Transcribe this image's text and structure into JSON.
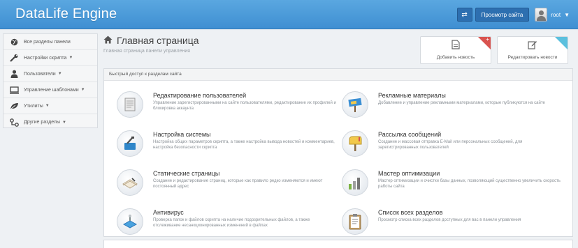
{
  "header": {
    "logo": "DataLife Engine",
    "swap_icon": "swap-icon",
    "view_site_label": "Просмотр сайта",
    "username": "root",
    "user_caret": "▼"
  },
  "sidebar": {
    "items": [
      {
        "label": "Все разделы панели",
        "icon": "globe-icon",
        "caret": ""
      },
      {
        "label": "Настройки скрипта",
        "icon": "wrench-icon",
        "caret": "▼"
      },
      {
        "label": "Пользователи",
        "icon": "user-icon",
        "caret": "▼"
      },
      {
        "label": "Управление шаблонами",
        "icon": "monitor-icon",
        "caret": "▼"
      },
      {
        "label": "Утилиты",
        "icon": "leaf-icon",
        "caret": "▼"
      },
      {
        "label": "Другие разделы",
        "icon": "sitemap-icon",
        "caret": "▼"
      }
    ]
  },
  "page": {
    "title": "Главная страница",
    "subtitle": "Главная страница панели управления"
  },
  "actions": {
    "add_news": "Добавить новость",
    "edit_news": "Редактировать новости"
  },
  "panel": {
    "heading": "Быстрый доступ к разделам сайта",
    "tiles": [
      {
        "title": "Редактирование пользователей",
        "desc": "Управление зарегистрированными на сайте пользователями, редактирование их профилей и блокировка аккаунта",
        "icon": "users-edit-icon"
      },
      {
        "title": "Рекламные материалы",
        "desc": "Добавление и управление рекламными материалами, которые публикуются на сайте",
        "icon": "ads-icon"
      },
      {
        "title": "Настройка системы",
        "desc": "Настройка общих параметров скрипта, а также настройка вывода новостей и комментариев, настройка безопасности скрипта",
        "icon": "system-settings-icon"
      },
      {
        "title": "Рассылка сообщений",
        "desc": "Создание и массовая отправка E-Mail или персональных сообщений, для зарегистрированных пользователей",
        "icon": "mailbox-icon"
      },
      {
        "title": "Статические страницы",
        "desc": "Создание и редактирование страниц, которые как правило редко изменяются и имеют постоянный адрес",
        "icon": "static-pages-icon"
      },
      {
        "title": "Мастер оптимизации",
        "desc": "Мастер оптимизации и очистки базы данных, позволяющий существенно увеличить скорость работы сайта",
        "icon": "optimization-icon"
      },
      {
        "title": "Антивирус",
        "desc": "Проверка папок и файлов скрипта на наличие подозрительных файлов, а также отслеживание несанкционированных изменений в файлах",
        "icon": "antivirus-icon"
      },
      {
        "title": "Список всех разделов",
        "desc": "Просмотр списка всех разделов доступных для вас в панели управления",
        "icon": "sections-list-icon"
      }
    ]
  }
}
